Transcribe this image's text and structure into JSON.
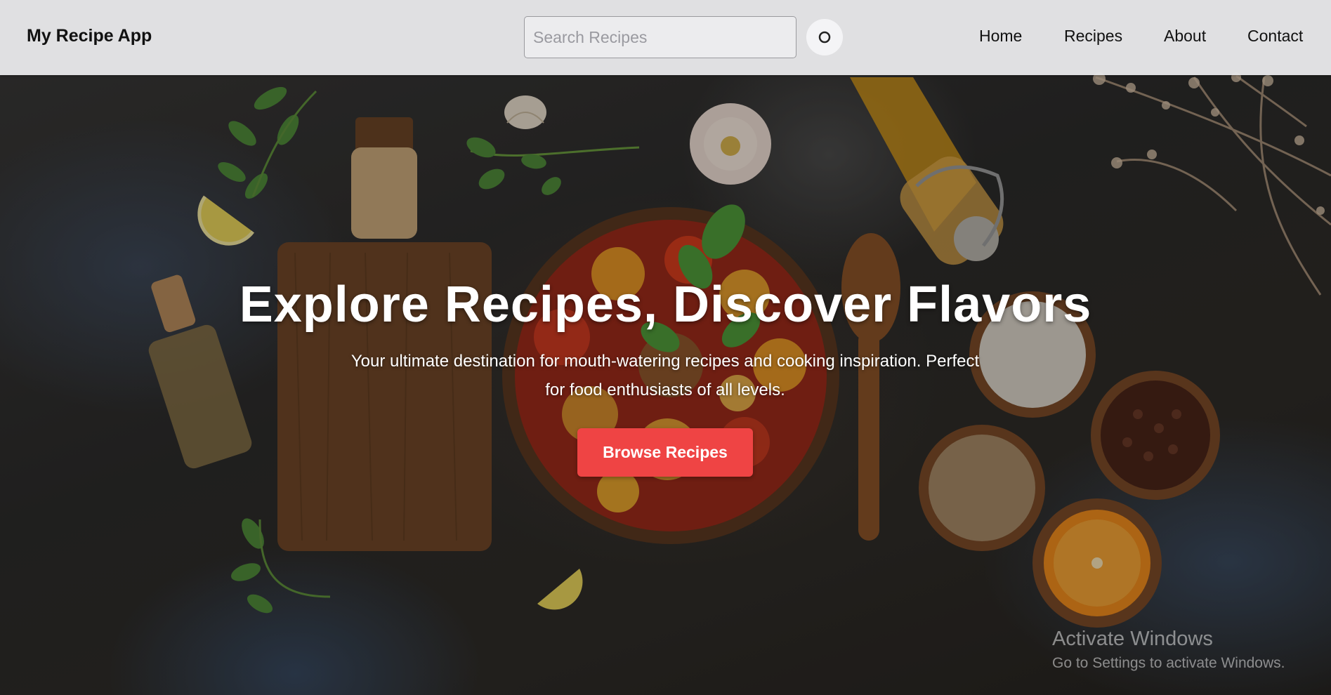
{
  "header": {
    "brand": "My Recipe App",
    "search": {
      "placeholder": "Search Recipes",
      "value": ""
    },
    "search_button_icon": "search-icon",
    "nav": [
      "Home",
      "Recipes",
      "About",
      "Contact"
    ]
  },
  "hero": {
    "title": "Explore Recipes, Discover Flavors",
    "subtitle_line1": "Your ultimate destination for mouth-watering recipes and cooking inspiration. Perfect",
    "subtitle_line2": "for food enthusiasts of all levels.",
    "cta_label": "Browse Recipes",
    "cta_color": "#ef4444"
  },
  "watermark": {
    "title": "Activate Windows",
    "subtitle": "Go to Settings to activate Windows."
  }
}
